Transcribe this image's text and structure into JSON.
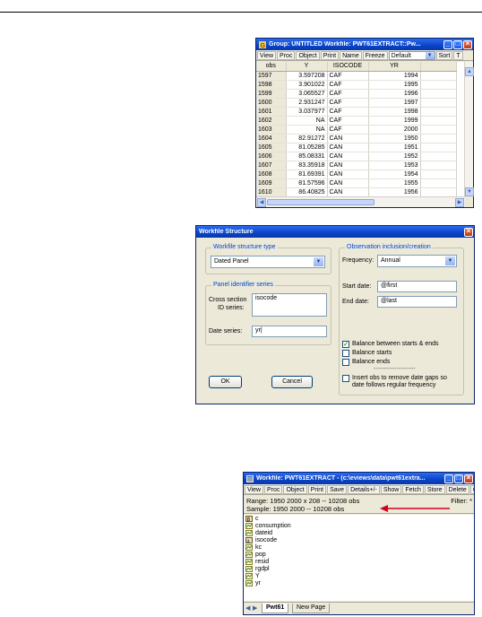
{
  "group_window": {
    "title": "Group: UNTITLED   Workfile: PWT61EXTRACT::Pw...",
    "toolbar": [
      "View",
      "Proc",
      "Object",
      "Print",
      "Name",
      "Freeze"
    ],
    "display_select": "Default",
    "toolbar_after": [
      "Sort",
      "T"
    ],
    "columns": [
      "obs",
      "Y",
      "ISOCODE",
      "YR"
    ],
    "rows": [
      [
        "1597",
        "3.597208",
        "CAF",
        "1994"
      ],
      [
        "1598",
        "3.901022",
        "CAF",
        "1995"
      ],
      [
        "1599",
        "3.065527",
        "CAF",
        "1996"
      ],
      [
        "1600",
        "2.931247",
        "CAF",
        "1997"
      ],
      [
        "1601",
        "3.037977",
        "CAF",
        "1998"
      ],
      [
        "1602",
        "NA",
        "CAF",
        "1999"
      ],
      [
        "1603",
        "NA",
        "CAF",
        "2000"
      ],
      [
        "1604",
        "82.91272",
        "CAN",
        "1950"
      ],
      [
        "1605",
        "81.05285",
        "CAN",
        "1951"
      ],
      [
        "1606",
        "85.08331",
        "CAN",
        "1952"
      ],
      [
        "1607",
        "83.35918",
        "CAN",
        "1953"
      ],
      [
        "1608",
        "81.69391",
        "CAN",
        "1954"
      ],
      [
        "1609",
        "81.57596",
        "CAN",
        "1955"
      ],
      [
        "1610",
        "86.40825",
        "CAN",
        "1956"
      ],
      [
        "1611",
        "",
        "",
        ""
      ]
    ]
  },
  "structure_dialog": {
    "title": "Workfile Structure",
    "structure_type_legend": "Workfile structure type",
    "structure_type_value": "Dated Panel",
    "panel_legend": "Panel identifier series",
    "cross_section_label_1": "Cross section",
    "cross_section_label_2": "ID series:",
    "cross_section_value": "isocode",
    "date_series_label": "Date series:",
    "date_series_value": "yr|",
    "obs_legend": "Observation inclusion/creation",
    "frequency_label": "Frequency:",
    "frequency_value": "Annual",
    "start_label": "Start date:",
    "start_value": "@first",
    "end_label": "End date:",
    "end_value": "@last",
    "balance_between": "Balance between starts & ends",
    "balance_starts": "Balance starts",
    "balance_ends": "Balance ends",
    "separator": "--------------------",
    "insert_obs_1": "Insert obs to remove date gaps so",
    "insert_obs_2": "date follows regular frequency",
    "ok_label": "OK",
    "cancel_label": "Cancel",
    "balance_between_checked": true,
    "check_glyph": "✓"
  },
  "workfile_window": {
    "title": "Workfile: PWT61EXTRACT - (c:\\eviews\\data\\pwt61extra...",
    "toolbar": [
      "View",
      "Proc",
      "Object",
      "Print",
      "Save",
      "Details+/-",
      "Show",
      "Fetch",
      "Store",
      "Delete",
      "Ge"
    ],
    "range": "Range:  1950 2000 x 208  --  10208 obs",
    "filter": "Filter: *",
    "sample": "Sample: 1950 2000  --  10208 obs",
    "objects": [
      {
        "name": "c",
        "icon": "coef-icon"
      },
      {
        "name": "consumption",
        "icon": "series-icon"
      },
      {
        "name": "dateid",
        "icon": "series-icon"
      },
      {
        "name": "isocode",
        "icon": "alpha-icon"
      },
      {
        "name": "kc",
        "icon": "series-icon"
      },
      {
        "name": "pop",
        "icon": "series-icon"
      },
      {
        "name": "resid",
        "icon": "series-icon"
      },
      {
        "name": "rgdpl",
        "icon": "series-icon"
      },
      {
        "name": "Y",
        "icon": "series-icon"
      },
      {
        "name": "yr",
        "icon": "series-icon"
      }
    ],
    "tabs": [
      "Pwt61",
      "New Page"
    ],
    "arrow_color": "#d0021b"
  }
}
